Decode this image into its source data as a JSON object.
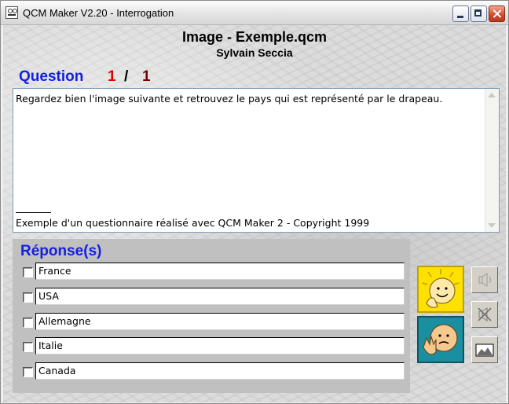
{
  "window": {
    "title": "QCM Maker V2.20 - Interrogation",
    "icon": "qcm-app-icon"
  },
  "header": {
    "title": "Image - Exemple.qcm",
    "author": "Sylvain Seccia"
  },
  "question": {
    "label": "Question",
    "current": "1",
    "separator": "/",
    "total": "1",
    "text": "Regardez bien l'image suivante et retrouvez le pays qui est représenté par le drapeau.",
    "footer": "Exemple d'un questionnaire réalisé avec QCM Maker 2 - Copyright 1999"
  },
  "answers": {
    "label": "Réponse(s)",
    "items": [
      {
        "text": "France",
        "checked": false
      },
      {
        "text": "USA",
        "checked": false
      },
      {
        "text": "Allemagne",
        "checked": false
      },
      {
        "text": "Italie",
        "checked": false
      },
      {
        "text": "Canada",
        "checked": false
      }
    ]
  },
  "buttons": {
    "validate_icon": "happy-face-icon",
    "cancel_icon": "sad-face-icon",
    "sound_icon": "speaker-icon",
    "mute_icon": "mute-icon",
    "image_icon": "image-icon"
  },
  "colors": {
    "label_blue": "#1420e0",
    "current_red": "#e00000",
    "total_darkred": "#7a0000",
    "panel_gray": "#c0c0c0",
    "happy_yellow": "#ffe100",
    "sad_teal": "#1a8fa0"
  }
}
